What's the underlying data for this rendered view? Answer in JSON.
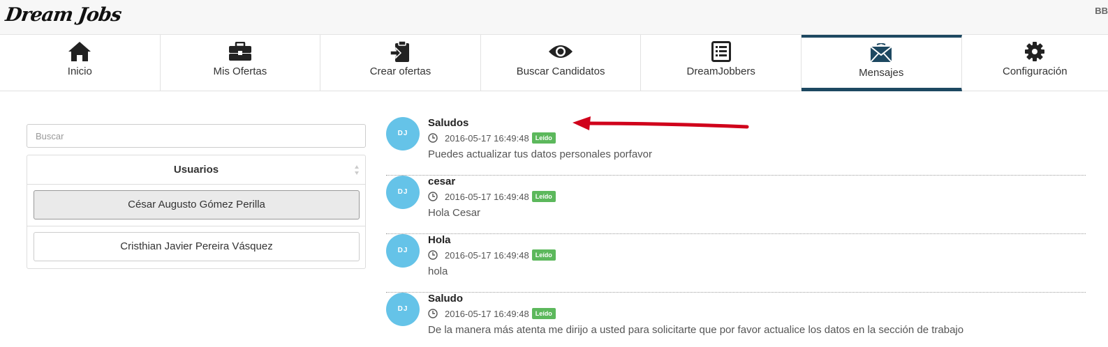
{
  "app": {
    "logo_text": "Dream Jobs",
    "user_initials": "BB"
  },
  "nav": [
    {
      "label": "Inicio",
      "icon": "home-icon",
      "active": false
    },
    {
      "label": "Mis Ofertas",
      "icon": "briefcase-icon",
      "active": false
    },
    {
      "label": "Crear ofertas",
      "icon": "clipboard-icon",
      "active": false
    },
    {
      "label": "Buscar Candidatos",
      "icon": "eye-icon",
      "active": false
    },
    {
      "label": "DreamJobbers",
      "icon": "list-icon",
      "active": false
    },
    {
      "label": "Mensajes",
      "icon": "envelope-icon",
      "active": true
    },
    {
      "label": "Configuración",
      "icon": "gear-icon",
      "active": false
    }
  ],
  "search": {
    "placeholder": "Buscar"
  },
  "users": {
    "header": "Usuarios",
    "items": [
      {
        "name": "César Augusto Gómez Perilla",
        "selected": true
      },
      {
        "name": "Cristhian Javier Pereira Vásquez",
        "selected": false
      }
    ]
  },
  "messages": [
    {
      "avatar": "DJ",
      "title": "Saludos",
      "timestamp": "2016-05-17 16:49:48",
      "status": "Leído",
      "body": "Puedes actualizar tus datos personales porfavor"
    },
    {
      "avatar": "DJ",
      "title": "cesar",
      "timestamp": "2016-05-17 16:49:48",
      "status": "Leído",
      "body": "Hola Cesar"
    },
    {
      "avatar": "DJ",
      "title": "Hola",
      "timestamp": "2016-05-17 16:49:48",
      "status": "Leído",
      "body": "hola"
    },
    {
      "avatar": "DJ",
      "title": "Saludo",
      "timestamp": "2016-05-17 16:49:48",
      "status": "Leído",
      "body": "De la manera más atenta me dirijo a usted para solicitarte que por favor actualice los datos en la sección de trabajo"
    }
  ],
  "colors": {
    "nav_active": "#1d4861",
    "avatar": "#65c3e8",
    "badge": "#5cb85c",
    "annotation_arrow": "#d0021b"
  }
}
